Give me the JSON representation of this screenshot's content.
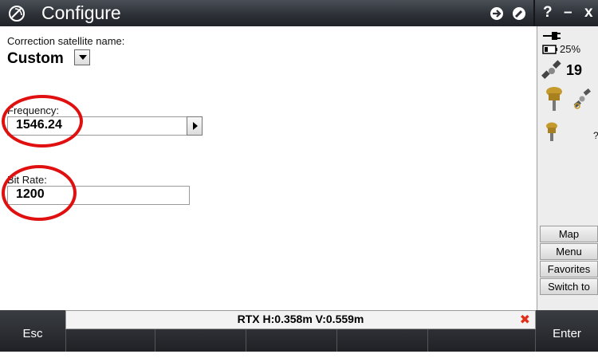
{
  "window": {
    "title": "Configure",
    "buttons": [
      "?",
      "–",
      "x"
    ]
  },
  "form": {
    "satellite": {
      "label": "Correction satellite name:",
      "value": "Custom"
    },
    "frequency": {
      "label": "Frequency:",
      "value": "1546.24"
    },
    "bit_rate": {
      "label": "Bit Rate:",
      "value": "1200"
    }
  },
  "status": {
    "battery": "25%",
    "satellites": "19",
    "receiver_status": "?"
  },
  "side_buttons": {
    "map": "Map",
    "menu": "Menu",
    "favorites": "Favorites",
    "switch_to": "Switch to"
  },
  "status_bar": {
    "rtx_text": "RTX H:0.358m V:0.559m"
  },
  "softkeys": {
    "esc": "Esc",
    "enter": "Enter"
  },
  "colors": {
    "titlebar": "#2d3137",
    "highlight_circle": "#e01010",
    "close_x": "#e0301a"
  }
}
